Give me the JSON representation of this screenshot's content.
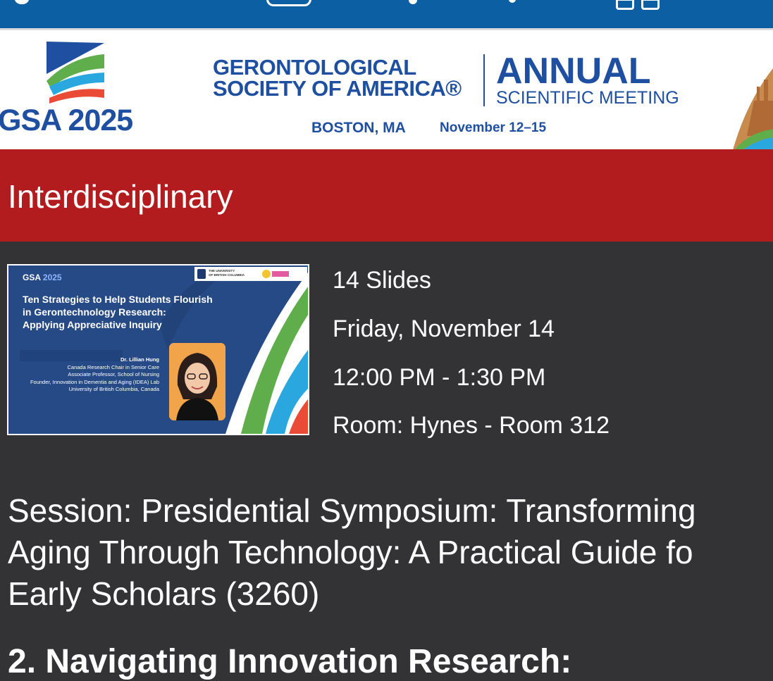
{
  "banner": {
    "logo_text": "GSA 2025",
    "org_line1": "GERONTOLOGICAL",
    "org_line2": "SOCIETY OF AMERICA®",
    "meeting_line1": "ANNUAL",
    "meeting_line2": "SCIENTIFIC MEETING",
    "location": "BOSTON, MA",
    "dates": "November 12–15"
  },
  "category": {
    "title": "Interdisciplinary"
  },
  "thumbnail": {
    "gsa_label": "GSA",
    "gsa_year": "2025",
    "title_line1": "Ten Strategies to Help Students Flourish",
    "title_line2": "in Gerontechnology Research:",
    "title_line3": "Applying Appreciative Inquiry",
    "speaker_name": "Dr. Lillian Hung",
    "speaker_line1": "Canada Research Chair in Senior Care",
    "speaker_line2": "Associate Professor, School of Nursing",
    "speaker_line3": "Founder, Innovation in Dementia and Aging (IDEA) Lab",
    "speaker_line4": "University of British Columbia, Canada",
    "university_logo_line1": "THE UNIVERSITY",
    "university_logo_line2": "OF BRITISH COLUMBIA"
  },
  "session": {
    "slides": "14 Slides",
    "date": "Friday, November 14",
    "time": "12:00 PM - 1:30 PM",
    "room": "Room: Hynes - Room 312",
    "description_line1": "Session: Presidential Symposium: Transforming",
    "description_line2": "Aging Through Technology: A Practical Guide fo",
    "description_line3": "Early Scholars (3260)",
    "next_heading": "2. Navigating Innovation Research:"
  },
  "colors": {
    "top_bar": "#0d5fa4",
    "brand_blue": "#1e4fa0",
    "category_red": "#b21c1e",
    "background": "#333336"
  }
}
